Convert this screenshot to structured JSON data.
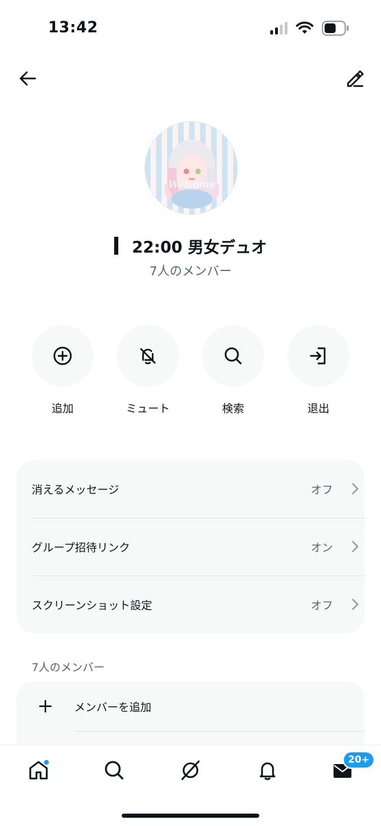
{
  "status_bar": {
    "time": "13:42",
    "icons": [
      "cellular-signal-icon",
      "wifi-icon",
      "battery-icon"
    ]
  },
  "top_nav": {
    "back_icon": "arrow-left-icon",
    "edit_icon": "edit-pencil-icon"
  },
  "group": {
    "avatar": "group-avatar",
    "title": "22:00 男女デュオ",
    "member_count": "7人のメンバー"
  },
  "actions": [
    {
      "label": "追加",
      "icon": "add-circle-icon"
    },
    {
      "label": "ミュート",
      "icon": "bell-off-icon"
    },
    {
      "label": "検索",
      "icon": "search-icon"
    },
    {
      "label": "退出",
      "icon": "leave-icon"
    }
  ],
  "settings": [
    {
      "label": "消えるメッセージ",
      "value": "オフ"
    },
    {
      "label": "グループ招待リンク",
      "value": "オン"
    },
    {
      "label": "スクリーンショット設定",
      "value": "オフ"
    }
  ],
  "members_section": {
    "heading": "7人のメンバー",
    "add_member_label": "メンバーを追加"
  },
  "tab_bar": {
    "tabs": [
      "home-icon",
      "search-icon",
      "grok-icon",
      "notifications-icon",
      "messages-icon"
    ],
    "messages_badge": "20+"
  },
  "colors": {
    "accent": "#1d9bf0",
    "text_primary": "#0f1419",
    "text_secondary": "#536471",
    "card_background": "#f7f8f8"
  }
}
